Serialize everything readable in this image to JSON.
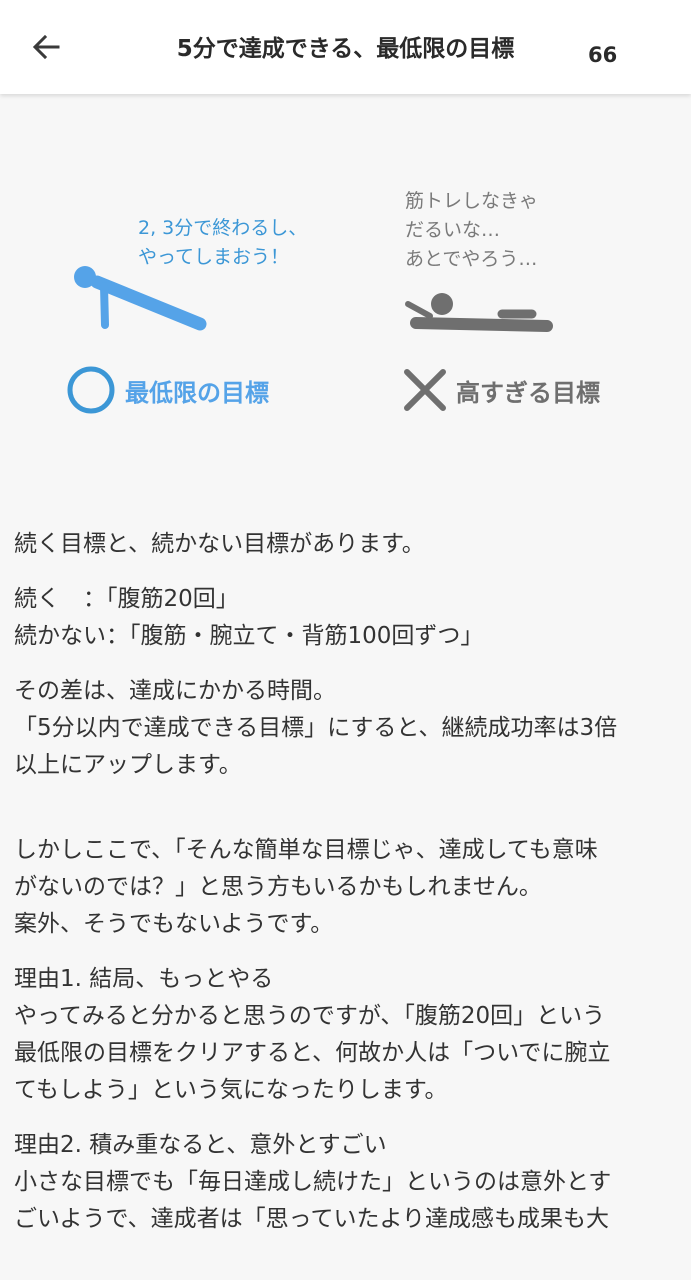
{
  "appbar": {
    "title": "5分で達成できる、最低限の目標",
    "count": "66"
  },
  "illustration": {
    "left_speech": [
      "2, 3分で終わるし、",
      "やってしまおう！"
    ],
    "right_speech": [
      "筋トレしなきゃ",
      "だるいな…",
      "あとでやろう…"
    ],
    "left_label": "最低限の目標",
    "right_label": "高すぎる目標",
    "colors": {
      "good": "#55a3e8",
      "bad": "#6f6f6f",
      "good_text": "#3c97d6"
    }
  },
  "article": {
    "paragraphs": [
      [
        "続く目標と、続かない目標があります。"
      ],
      [
        "続く　：「腹筋20回」",
        "続かない：「腹筋・腕立て・背筋100回ずつ」"
      ],
      [
        "その差は、達成にかかる時間。",
        "「5分以内で達成できる目標」にすると、継続成功率は3倍",
        "以上にアップします。"
      ],
      [
        "しかしここで、「そんな簡単な目標じゃ、達成しても意味",
        "がないのでは？」と思う方もいるかもしれません。",
        "案外、そうでもないようです。"
      ],
      [
        "理由1. 結局、もっとやる",
        "やってみると分かると思うのですが、「腹筋20回」という",
        "最低限の目標をクリアすると、何故か人は「ついでに腕立",
        "てもしよう」という気になったりします。"
      ],
      [
        "理由2. 積み重なると、意外とすごい",
        "小さな目標でも「毎日達成し続けた」というのは意外とす",
        "ごいようで、達成者は「思っていたより達成感も成果も大"
      ]
    ]
  }
}
